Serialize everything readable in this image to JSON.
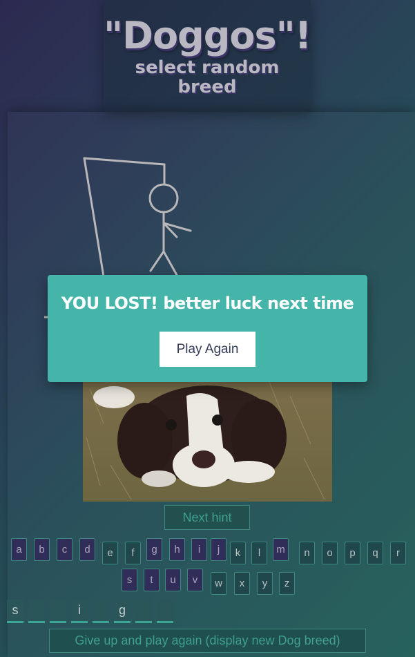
{
  "header": {
    "title": "\"Doggos\"!",
    "subtitle": "select random breed"
  },
  "modal": {
    "title": "YOU LOST! better luck next time",
    "button": "Play Again"
  },
  "hint_button": "Next hint",
  "keyboard": {
    "row1": [
      {
        "letter": "a",
        "used": true
      },
      {
        "letter": "b",
        "used": true
      },
      {
        "letter": "c",
        "used": true
      },
      {
        "letter": "d",
        "used": true
      },
      {
        "letter": "e",
        "used": false
      },
      {
        "letter": "f",
        "used": false
      },
      {
        "letter": "g",
        "used": true
      },
      {
        "letter": "h",
        "used": true
      },
      {
        "letter": "i",
        "used": true
      },
      {
        "letter": "j",
        "used": true
      },
      {
        "letter": "k",
        "used": false
      },
      {
        "letter": "l",
        "used": false
      },
      {
        "letter": "m",
        "used": true
      },
      {
        "letter": "n",
        "used": false
      },
      {
        "letter": "o",
        "used": false
      },
      {
        "letter": "p",
        "used": false
      },
      {
        "letter": "q",
        "used": false
      },
      {
        "letter": "r",
        "used": false
      }
    ],
    "row2": [
      {
        "letter": "s",
        "used": true
      },
      {
        "letter": "t",
        "used": true
      },
      {
        "letter": "u",
        "used": true
      },
      {
        "letter": "v",
        "used": true
      },
      {
        "letter": "w",
        "used": false
      },
      {
        "letter": "x",
        "used": false
      },
      {
        "letter": "y",
        "used": false
      },
      {
        "letter": "z",
        "used": false
      }
    ]
  },
  "word_slots": [
    "s",
    "",
    "",
    "i",
    "",
    "g",
    "",
    ""
  ],
  "give_up_button": "Give up and play again (display new Dog breed)",
  "colors": {
    "modal_bg": "#46b5a9",
    "accent": "#3fa08d",
    "used_key": "#302d58"
  }
}
